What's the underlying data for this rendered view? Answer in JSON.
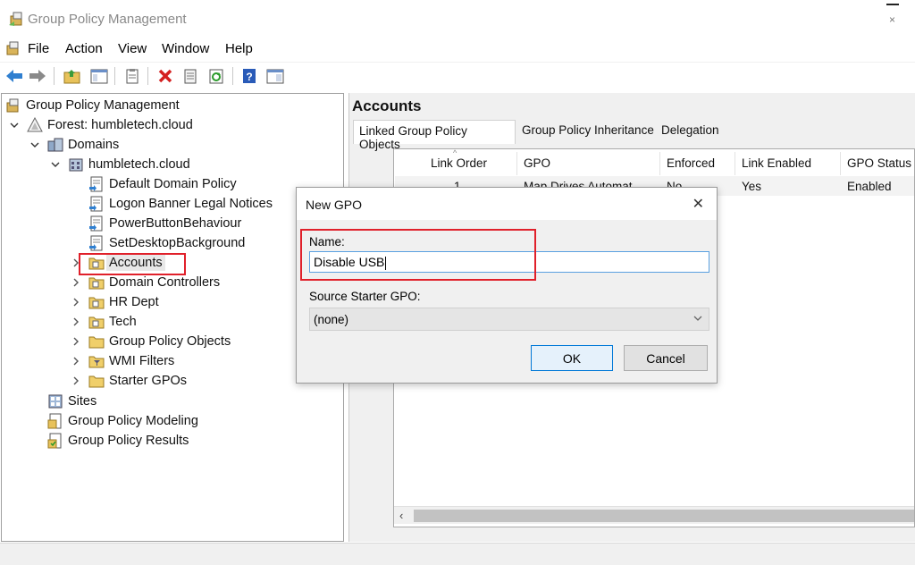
{
  "window": {
    "title": "Group Policy Management"
  },
  "menu": [
    "File",
    "Action",
    "View",
    "Window",
    "Help"
  ],
  "toolbar": {
    "icons": [
      "back-arrow-icon",
      "forward-arrow-icon",
      "up-folder-icon",
      "show-hide-tree-icon",
      "properties-icon",
      "delete-icon",
      "export-icon",
      "refresh-icon",
      "help-icon",
      "console-icon"
    ]
  },
  "tree": {
    "root": "Group Policy Management",
    "forest": "Forest: humbletech.cloud",
    "domains": "Domains",
    "domain": "humbletech.cloud",
    "gpo_links": [
      "Default Domain Policy",
      "Logon Banner Legal Notices",
      "PowerButtonBehaviour",
      "SetDesktopBackground"
    ],
    "ous": [
      "Accounts",
      "Domain Controllers",
      "HR Dept",
      "Tech",
      "Group Policy Objects",
      "WMI Filters",
      "Starter GPOs"
    ],
    "sites": "Sites",
    "modeling": "Group Policy Modeling",
    "results": "Group Policy Results"
  },
  "right": {
    "title": "Accounts",
    "tabs": [
      "Linked Group Policy Objects",
      "Group Policy Inheritance",
      "Delegation"
    ],
    "columns": [
      "Link Order",
      "GPO",
      "Enforced",
      "Link Enabled",
      "GPO Status"
    ],
    "rows": [
      {
        "link_order": "1",
        "gpo": "Map Drives Automat",
        "enforced": "No",
        "link_enabled": "Yes",
        "gpo_status": "Enabled"
      }
    ]
  },
  "dialog": {
    "title": "New GPO",
    "close": "✕",
    "name_label": "Name:",
    "name_value": "Disable USB",
    "source_label": "Source Starter GPO:",
    "source_value": "(none)",
    "ok": "OK",
    "cancel": "Cancel"
  },
  "colors": {
    "highlight_box": "#e0202a",
    "ok_border": "#0078d7"
  }
}
